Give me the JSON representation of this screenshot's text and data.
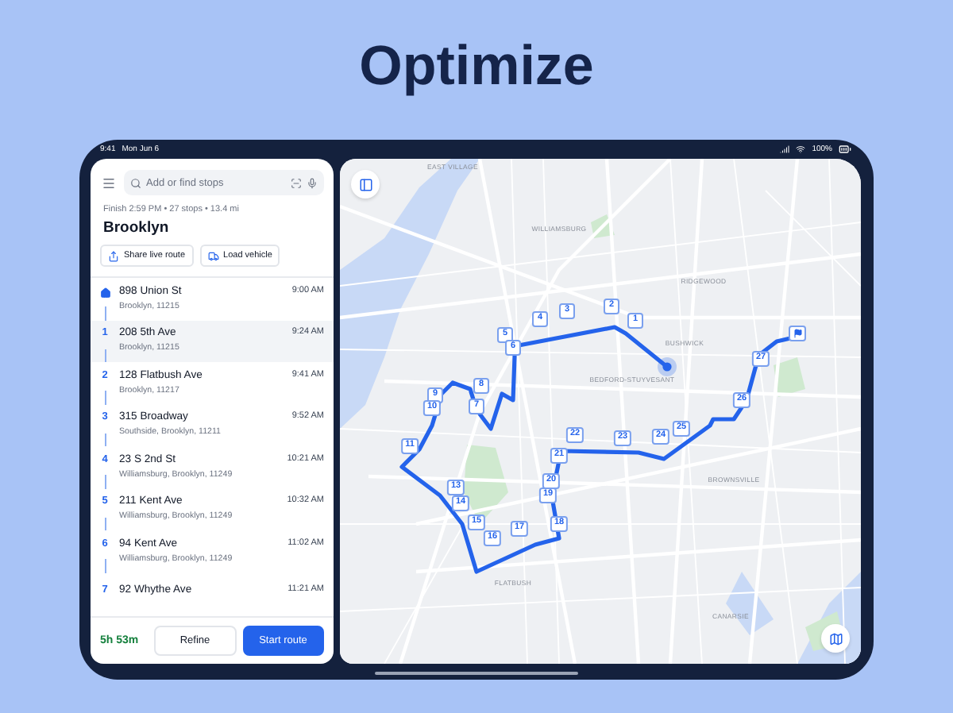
{
  "headline": "Optimize",
  "status_bar": {
    "time": "9:41",
    "date": "Mon Jun 6",
    "battery": "100%"
  },
  "route_panel": {
    "search": {
      "placeholder": "Add or find stops"
    },
    "summary": "Finish 2:59 PM • 27 stops • 13.4 mi",
    "title": "Brooklyn",
    "actions": [
      {
        "label": "Share live route",
        "kind": "share"
      },
      {
        "label": "Load vehicle",
        "kind": "vehicle"
      }
    ],
    "stops": [
      {
        "kind": "start",
        "name": "898 Union St",
        "area": "Brooklyn, 11215",
        "time": "9:00 AM",
        "selected": false
      },
      {
        "kind": "stop",
        "number": "1",
        "name": "208 5th Ave",
        "area": "Brooklyn, 11215",
        "time": "9:24 AM",
        "selected": true
      },
      {
        "kind": "stop",
        "number": "2",
        "name": "128 Flatbush Ave",
        "area": "Brooklyn, 11217",
        "time": "9:41 AM",
        "selected": false
      },
      {
        "kind": "stop",
        "number": "3",
        "name": "315 Broadway",
        "area": "Southside, Brooklyn, 11211",
        "time": "9:52 AM",
        "selected": false
      },
      {
        "kind": "stop",
        "number": "4",
        "name": "23 S 2nd St",
        "area": "Williamsburg, Brooklyn, 11249",
        "time": "10:21 AM",
        "selected": false
      },
      {
        "kind": "stop",
        "number": "5",
        "name": "211 Kent Ave",
        "area": "Williamsburg, Brooklyn, 11249",
        "time": "10:32 AM",
        "selected": false
      },
      {
        "kind": "stop",
        "number": "6",
        "name": "94 Kent Ave",
        "area": "Williamsburg, Brooklyn, 11249",
        "time": "11:02 AM",
        "selected": false
      },
      {
        "kind": "stop",
        "number": "7",
        "name": "92 Whythe Ave",
        "time": "11:21 AM",
        "selected": false
      }
    ],
    "footer": {
      "duration": "5h 53m",
      "buttons": [
        {
          "label": "Refine",
          "kind": "secondary"
        },
        {
          "label": "Start route",
          "kind": "primary"
        }
      ]
    }
  },
  "map": {
    "area_labels": [
      "EAST VILLAGE",
      "WILLIAMSBURG",
      "RIDGEWOOD",
      "BUSHWICK",
      "BEDFORD-STUYVESANT",
      "BROWNSVILLE",
      "FLATBUSH",
      "CANARSIE"
    ],
    "pins": [
      {
        "kind": "stop",
        "label": "1"
      },
      {
        "kind": "stop",
        "label": "2"
      },
      {
        "kind": "stop",
        "label": "3"
      },
      {
        "kind": "stop",
        "label": "4"
      },
      {
        "kind": "stop",
        "label": "5"
      },
      {
        "kind": "stop",
        "label": "6"
      },
      {
        "kind": "stop",
        "label": "7"
      },
      {
        "kind": "stop",
        "label": "8"
      },
      {
        "kind": "stop",
        "label": "9"
      },
      {
        "kind": "stop",
        "label": "10"
      },
      {
        "kind": "stop",
        "label": "11"
      },
      {
        "kind": "stop",
        "label": "13"
      },
      {
        "kind": "stop",
        "label": "14"
      },
      {
        "kind": "stop",
        "label": "15"
      },
      {
        "kind": "stop",
        "label": "16"
      },
      {
        "kind": "stop",
        "label": "17"
      },
      {
        "kind": "stop",
        "label": "18"
      },
      {
        "kind": "stop",
        "label": "19"
      },
      {
        "kind": "stop",
        "label": "20"
      },
      {
        "kind": "stop",
        "label": "21"
      },
      {
        "kind": "stop",
        "label": "22"
      },
      {
        "kind": "stop",
        "label": "23"
      },
      {
        "kind": "stop",
        "label": "24"
      },
      {
        "kind": "stop",
        "label": "25"
      },
      {
        "kind": "stop",
        "label": "26"
      },
      {
        "kind": "stop",
        "label": "27"
      },
      {
        "kind": "finish"
      }
    ]
  }
}
